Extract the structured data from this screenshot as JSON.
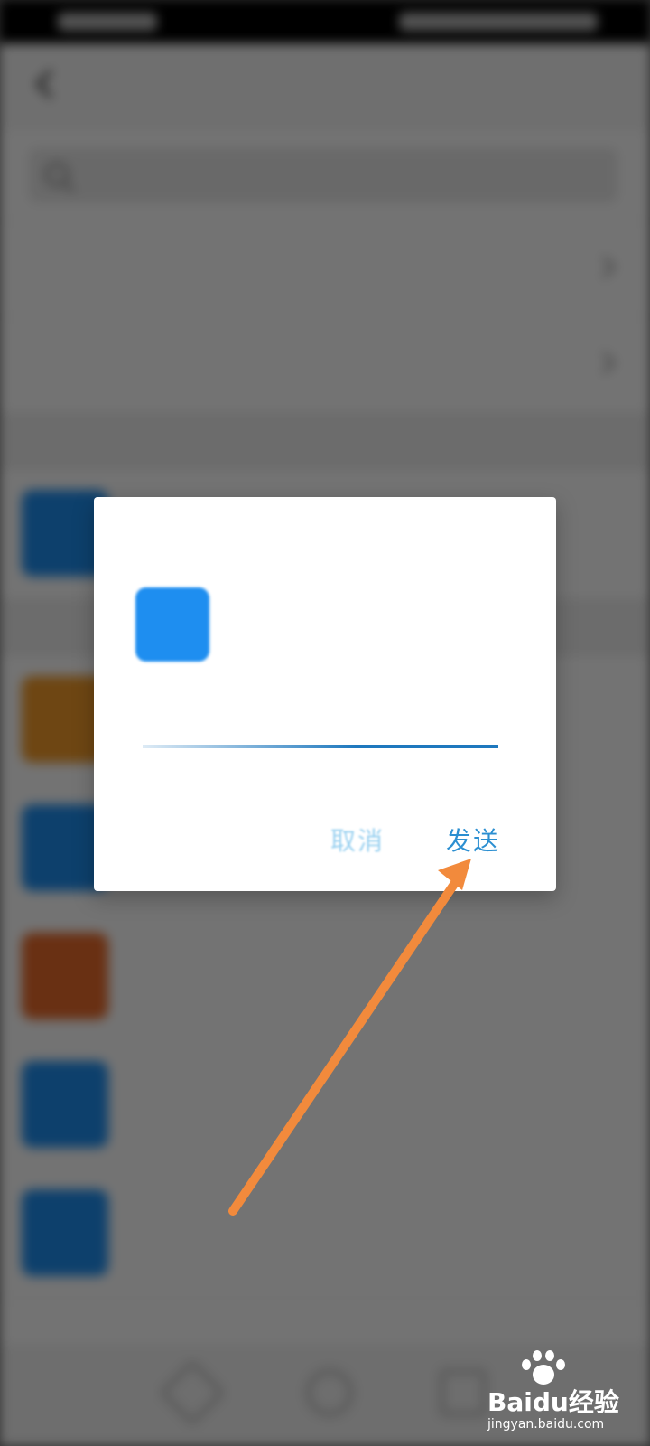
{
  "dialog": {
    "send_label": "发送",
    "cancel_label": "取消"
  },
  "annotation": {
    "arrow_color": "#f28a3c"
  },
  "watermark": {
    "brand": "Bai",
    "brand_suffix": "经验",
    "site": "jingyan.baidu.com"
  },
  "colors": {
    "accent": "#2c8fd1",
    "avatar_blue": "#1e8ef0",
    "avatar_orange": "#f39b2a",
    "avatar_red_orange": "#e96a2a"
  }
}
